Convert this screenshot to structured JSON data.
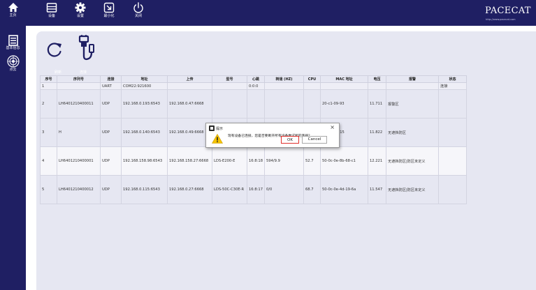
{
  "sidebar": {
    "items": [
      {
        "label": "主页",
        "icon": "home-icon"
      },
      {
        "label": "基本信息",
        "icon": "document-icon"
      },
      {
        "label": "点云",
        "icon": "radar-icon"
      }
    ]
  },
  "toolbar": {
    "buttons": [
      {
        "label": "设备",
        "icon": "device-icon"
      },
      {
        "label": "设置",
        "icon": "gear-icon"
      },
      {
        "label": "最小化",
        "icon": "minimize-icon"
      },
      {
        "label": "关闭",
        "icon": "power-icon"
      }
    ]
  },
  "brand": {
    "logo": "PACECAT",
    "url": "http://www.pacecat.com"
  },
  "tools": {
    "refresh_label": "刷新",
    "connect_label": "连接"
  },
  "table": {
    "columns": [
      "序号",
      "序列号",
      "连接",
      "地址",
      "上传",
      "型号",
      "心跳",
      "转速 (HZ)",
      "CPU",
      "MAC 地址",
      "电压",
      "报警",
      "状态"
    ],
    "rows": [
      [
        "1",
        "",
        "UART",
        "COM22:921600",
        "",
        "",
        "0:0:0",
        "",
        "",
        "",
        "",
        "",
        "连接"
      ],
      [
        "2",
        "LH6401210400011",
        "UDP",
        "192.168.0.193:6543",
        "192.168.0.47:6668",
        "",
        "",
        "",
        "",
        "20-c1-09-93",
        "11.711",
        "报警区",
        ""
      ],
      [
        "3",
        "H",
        "UDP",
        "192.168.0.140:6543",
        "192.168.0.49:6668",
        "",
        "",
        "",
        "",
        "0e-5b-7e-15",
        "11.822",
        "无遮挡防区",
        ""
      ],
      [
        "4",
        "LH6401210400001",
        "UDP",
        "192.168.158.98:6543",
        "192.168.158.27:6668",
        "LDS-E200-E",
        "16:8:18",
        "594/9.9",
        "52.7",
        "50-0c-0e-8b-68-c1",
        "12.221",
        "无遮挡防区|防区未定义",
        ""
      ],
      [
        "5",
        "LH6401210400012",
        "UDP",
        "192.168.0.115:6543",
        "192.168.0.27:6668",
        "LDS-50C-C30E-R",
        "16:8:17",
        "0/0",
        "68.7",
        "50-0c-0e-4d-19-6a",
        "11.547",
        "无遮挡防区|防区未定义",
        ""
      ]
    ]
  },
  "dialog": {
    "title": "提示",
    "message": "现有设备已连接，您是否要断开所有设备尝试新的连接？",
    "ok": "OK",
    "cancel": "Cancel",
    "close": "×"
  }
}
